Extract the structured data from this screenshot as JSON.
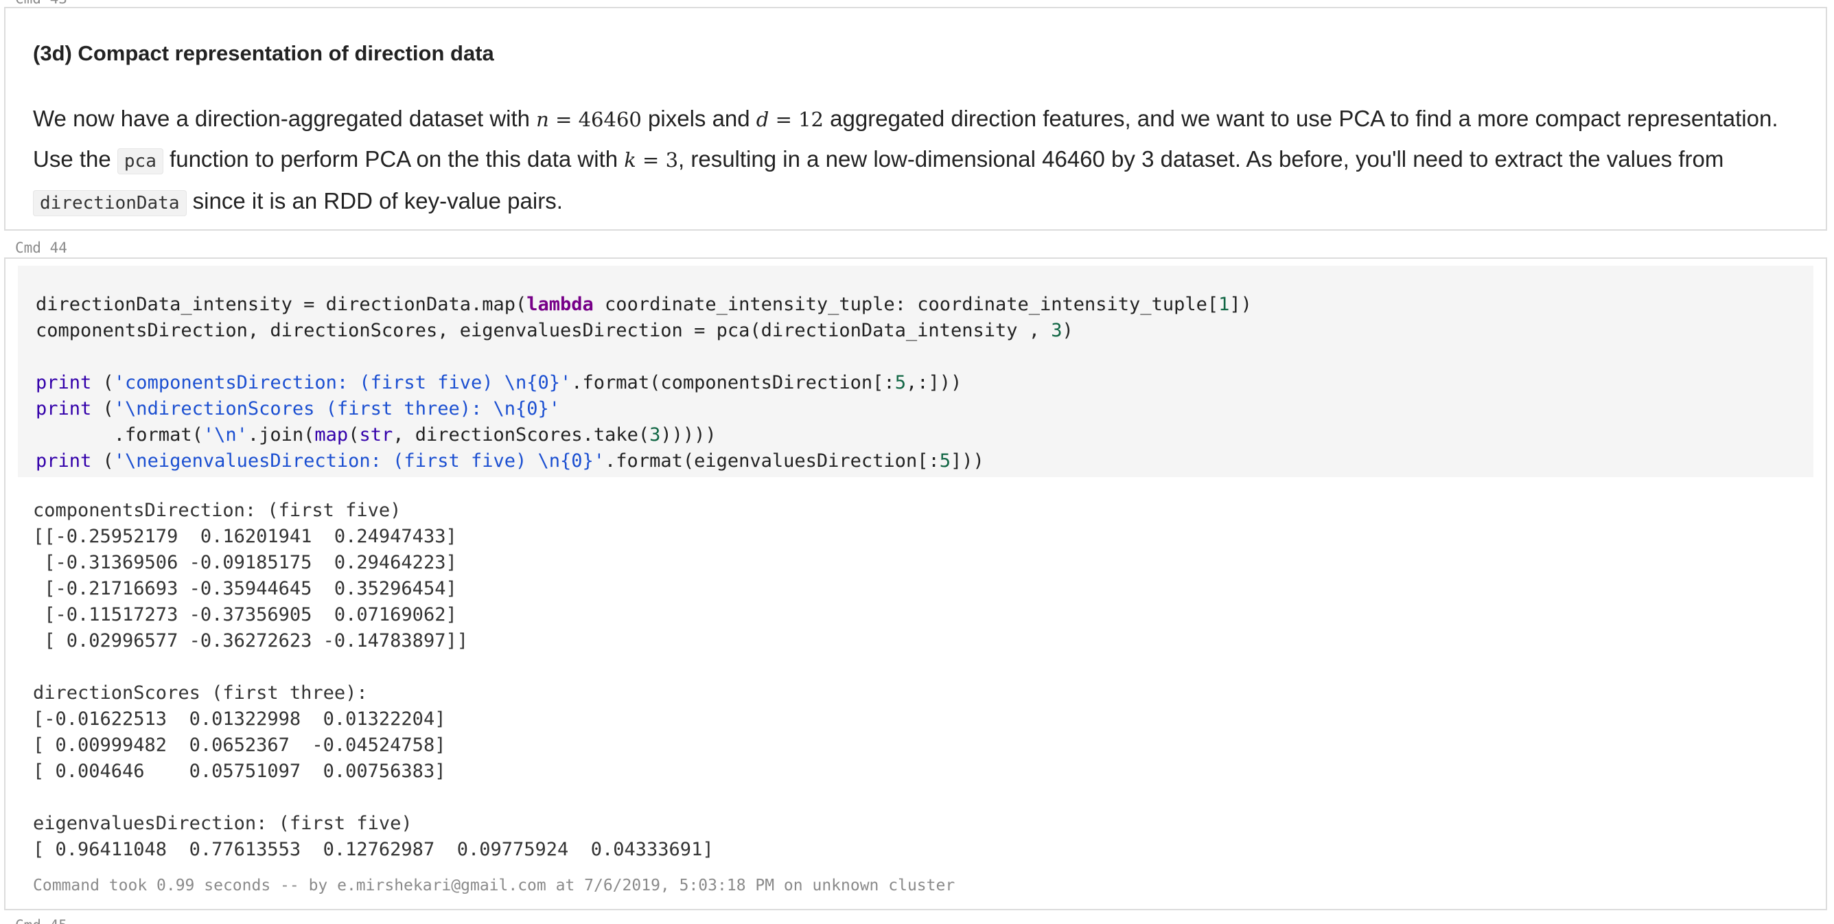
{
  "cells": {
    "prev_cmd_label": "Cmd 43",
    "next_cmd_label": "Cmd 45",
    "markdown": {
      "heading": "(3d) Compact representation of direction data",
      "p1_a": "We now have a direction-aggregated dataset with ",
      "n_var": "n",
      "n_eq": " = 46460",
      "p1_b": " pixels and ",
      "d_var": "d",
      "d_eq": " = 12",
      "p1_c": " aggregated direction features, and we want to use PCA to find a more compact representation. Use the ",
      "code_pca": "pca",
      "p1_d": " function to perform PCA on the this data with ",
      "k_var": "k",
      "k_eq": " = 3",
      "p1_e": ", resulting in a new low-dimensional 46460 by 3 dataset. As before, you'll need to extract the values from ",
      "code_direction_data": "directionData",
      "p1_f": " since it is an RDD of key-value pairs."
    },
    "code": {
      "cmd_label": "Cmd 44",
      "l1_a": "directionData_intensity = directionData.map(",
      "l1_kw": "lambda",
      "l1_b": " coordinate_intensity_tuple: coordinate_intensity_tuple[",
      "l1_n": "1",
      "l1_c": "])",
      "l2_a": "componentsDirection, directionScores, eigenvaluesDirection = pca(directionData_intensity , ",
      "l2_n": "3",
      "l2_c": ")",
      "l4_kw": "print",
      "l4_a": " (",
      "l4_s": "'componentsDirection: (first five) \\n{0}'",
      "l4_b": ".format(componentsDirection[:",
      "l4_n": "5",
      "l4_c": ",:]))",
      "l5_kw": "print",
      "l5_a": " (",
      "l5_s": "'\\ndirectionScores (first three): \\n{0}'",
      "l6_a": "       .format(",
      "l6_s": "'\\n'",
      "l6_b": ".join(",
      "l6_map": "map",
      "l6_c": "(",
      "l6_str": "str",
      "l6_d": ", directionScores.take(",
      "l6_n": "3",
      "l6_e": ")))))",
      "l7_kw": "print",
      "l7_a": " (",
      "l7_s": "'\\neigenvaluesDirection: (first five) \\n{0}'",
      "l7_b": ".format(eigenvaluesDirection[:",
      "l7_n": "5",
      "l7_c": "]))"
    },
    "output": {
      "lines": [
        "componentsDirection: (first five)",
        "[[-0.25952179  0.16201941  0.24947433]",
        " [-0.31369506 -0.09185175  0.29464223]",
        " [-0.21716693 -0.35944645  0.35296454]",
        " [-0.11517273 -0.37356905  0.07169062]",
        " [ 0.02996577 -0.36272623 -0.14783897]]",
        "",
        "directionScores (first three):",
        "[-0.01622513  0.01322998  0.01322204]",
        "[ 0.00999482  0.0652367  -0.04524758]",
        "[ 0.004646    0.05751097  0.00756383]",
        "",
        "eigenvaluesDirection: (first five)",
        "[ 0.96411048  0.77613553  0.12762987  0.09775924  0.04333691]"
      ]
    },
    "footer": "Command took 0.99 seconds -- by e.mirshekari@gmail.com at 7/6/2019, 5:03:18 PM on unknown cluster"
  }
}
